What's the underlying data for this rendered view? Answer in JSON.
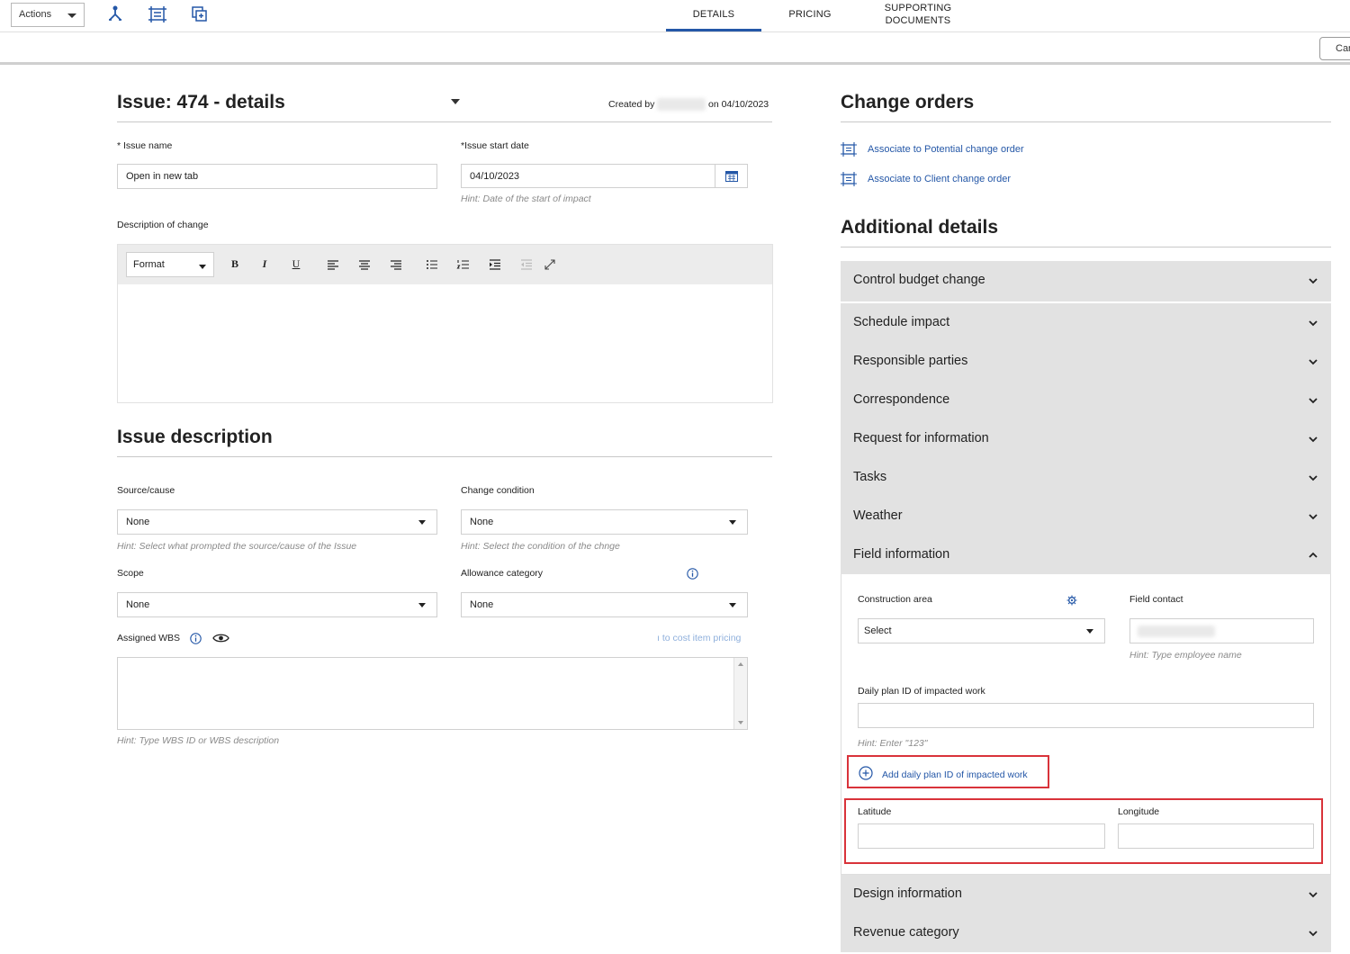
{
  "topbar": {
    "actions_label": "Actions",
    "tabs": [
      {
        "label": "DETAILS"
      },
      {
        "label": "PRICING"
      },
      {
        "label": "SUPPORTING"
      },
      {
        "label": "DOCUMENTS"
      }
    ],
    "cancel_label": "Car",
    "icons": [
      "split-icon",
      "frame-icon",
      "copy-add-icon"
    ]
  },
  "details": {
    "title": "Issue: 474 - details",
    "created_by_prefix": "Created by",
    "created_on": "on 04/10/2023",
    "issue_name_label": "* Issue name",
    "issue_name_value": "Open in new tab",
    "start_date_label": "*Issue start date",
    "start_date_value": "04/10/2023",
    "start_date_hint": "Hint: Date of the start of impact",
    "description_label": "Description of change",
    "editor_format_label": "Format"
  },
  "issue_description": {
    "title": "Issue description",
    "source_label": "Source/cause",
    "source_value": "None",
    "source_hint": "Hint: Select what prompted the source/cause of the Issue",
    "condition_label": "Change condition",
    "condition_value": "None",
    "condition_hint": "Hint: Select the condition of the chnge",
    "scope_label": "Scope",
    "scope_value": "None",
    "allowance_label": "Allowance category",
    "allowance_value": "None",
    "wbs_label": "Assigned WBS",
    "wbs_link": "ı to cost item pricing",
    "wbs_hint": "Hint: Type WBS ID or WBS description"
  },
  "change_orders": {
    "title": "Change orders",
    "links": [
      {
        "label": "Associate to Potential change order"
      },
      {
        "label": "Associate to Client change order"
      }
    ]
  },
  "additional": {
    "title": "Additional details",
    "sections": [
      {
        "label": "Control budget change"
      },
      {
        "label": "Schedule impact"
      },
      {
        "label": "Responsible parties"
      },
      {
        "label": "Correspondence"
      },
      {
        "label": "Request for information"
      },
      {
        "label": "Tasks"
      },
      {
        "label": "Weather"
      },
      {
        "label": "Field information"
      },
      {
        "label": "Design information"
      },
      {
        "label": "Revenue category"
      }
    ],
    "field_info": {
      "construction_area_label": "Construction area",
      "construction_area_value": "Select",
      "field_contact_label": "Field contact",
      "field_contact_hint": "Hint: Type employee name",
      "daily_plan_label": "Daily plan ID of impacted work",
      "daily_plan_hint": "Hint: Enter \"123\"",
      "add_daily_plan_label": "Add daily plan ID of impacted work",
      "latitude_label": "Latitude",
      "longitude_label": "Longitude"
    }
  },
  "colors": {
    "accent": "#2457a7",
    "accordion_bg": "#e2e2e2",
    "highlight": "#d9333a"
  }
}
